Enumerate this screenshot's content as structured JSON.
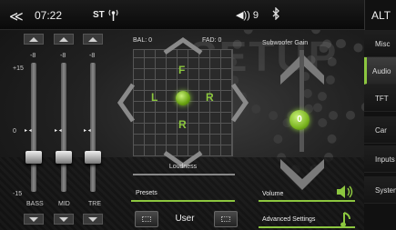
{
  "status_bar": {
    "back_glyph": "≪",
    "time": "07:22",
    "radio_mode": "ST",
    "antenna_icon": "antenna-icon",
    "volume_glyph": "◀))",
    "volume_level": "9",
    "bluetooth_icon": "bluetooth-icon",
    "right_title": "ALT"
  },
  "background_text": "SETUP",
  "equalizer": {
    "scale_top": "+15",
    "scale_mid": "0",
    "scale_bottom": "-15",
    "bands": [
      {
        "label": "BASS",
        "value": "-8",
        "level": -8
      },
      {
        "label": "MID",
        "value": "-8",
        "level": -8
      },
      {
        "label": "TRE",
        "value": "-8",
        "level": -8
      }
    ]
  },
  "balance_fader": {
    "bal_label": "BAL: 0",
    "fad_label": "FAD: 0",
    "front_letter": "F",
    "rear_letter": "R",
    "left_letter": "L",
    "right_letter": "R"
  },
  "loudness": {
    "label": "Loudness"
  },
  "subwoofer": {
    "label": "Subwoofer Gain",
    "value": "0"
  },
  "presets": {
    "label": "Presets",
    "value": "User"
  },
  "volume": {
    "label": "Volume",
    "icon": "speaker-icon"
  },
  "advanced": {
    "label": "Advanced Settings",
    "icon": "music-note-icon"
  },
  "accent_color": "#8cc63f",
  "menu": {
    "items": [
      {
        "label": "Misc",
        "active": false
      },
      {
        "label": "Audio",
        "active": true
      },
      {
        "label": "TFT",
        "active": false
      },
      {
        "label": "Car",
        "active": false
      },
      {
        "label": "Inputs",
        "active": false
      },
      {
        "label": "System",
        "active": false
      }
    ]
  }
}
